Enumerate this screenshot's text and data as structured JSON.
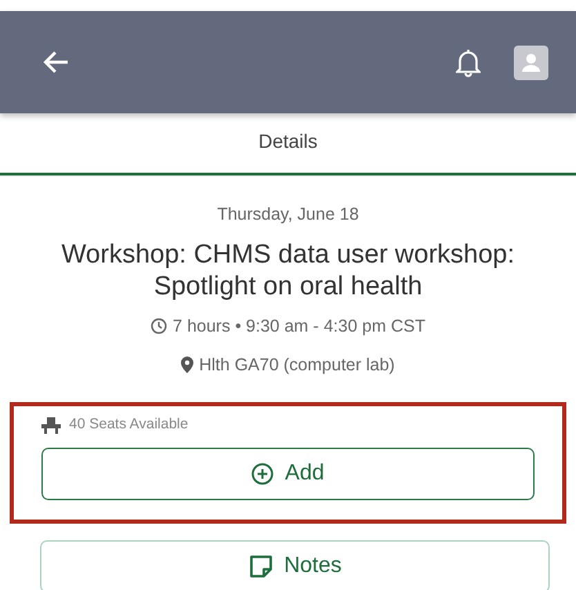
{
  "tabs": [
    {
      "label": "Details",
      "selected": true
    }
  ],
  "event": {
    "date": "Thursday, June 18",
    "title": "Workshop: CHMS data user workshop: Spotlight on oral health",
    "time": "7 hours • 9:30 am - 4:30 pm CST",
    "location": "Hlth GA70 (computer lab)"
  },
  "booking": {
    "highlighted": true,
    "seats": "40 Seats Available",
    "button": "Add"
  },
  "notes_button": "Notes"
}
